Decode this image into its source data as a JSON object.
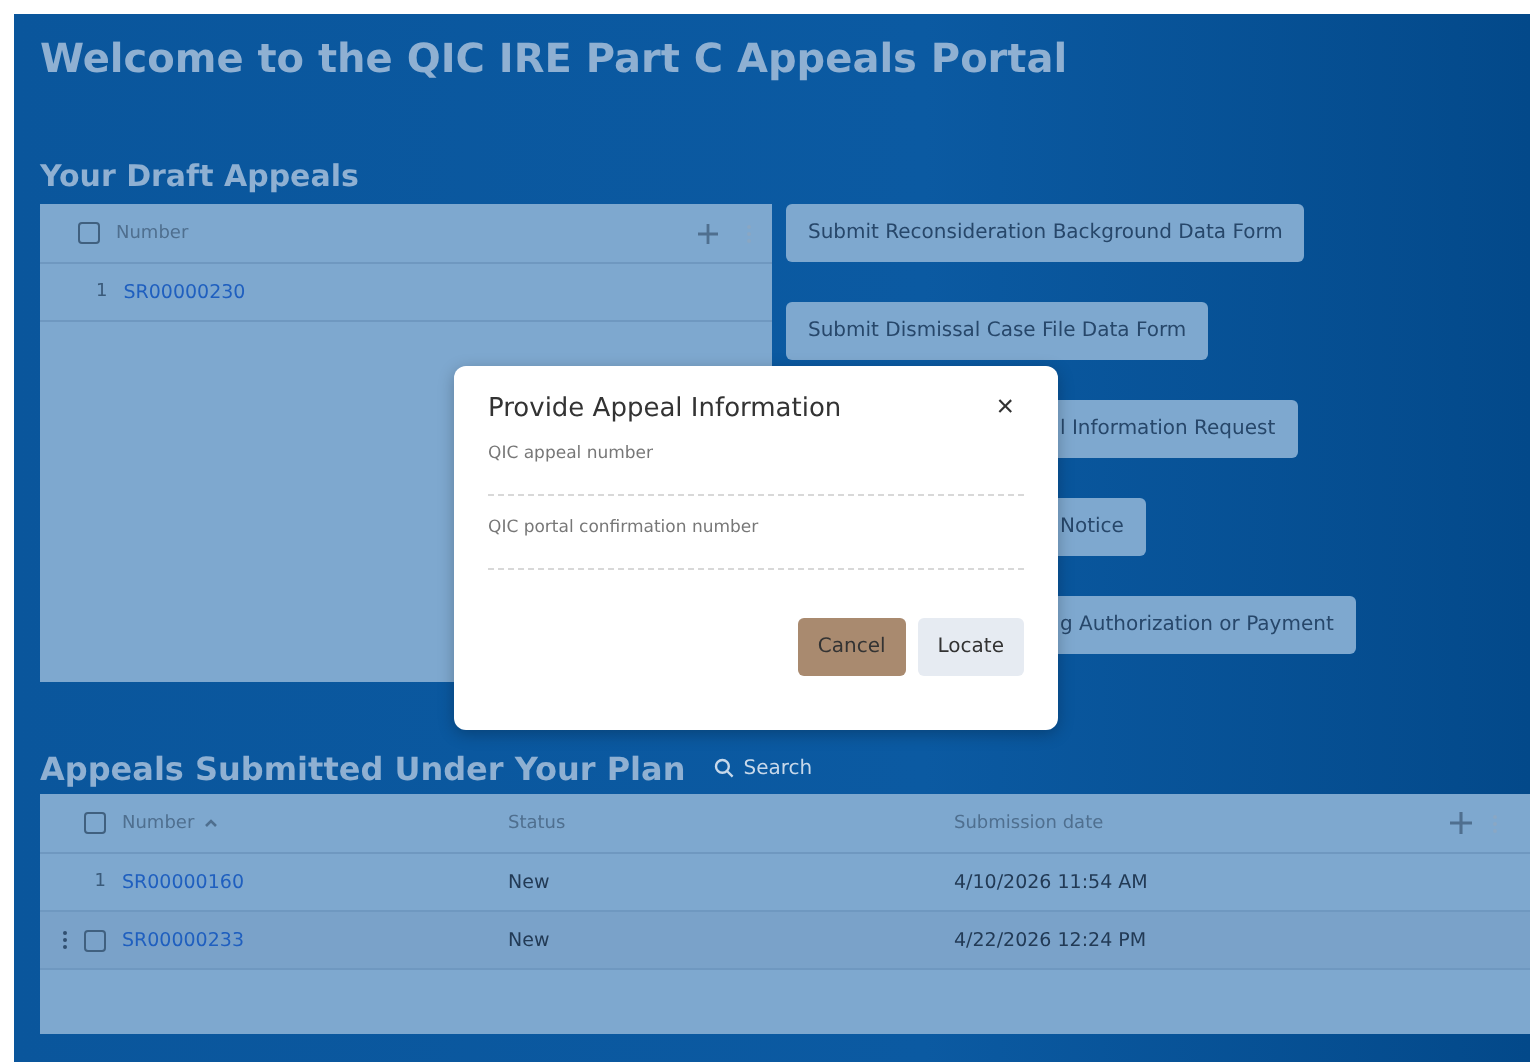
{
  "page_title": "Welcome to the QIC IRE Part C Appeals Portal",
  "draft_appeals": {
    "heading": "Your Draft Appeals",
    "select_all_checked": false,
    "columns": [
      {
        "label": "Number"
      }
    ],
    "rows": [
      {
        "index": "1",
        "number": "SR00000230"
      }
    ]
  },
  "actions": [
    {
      "label": "Submit Reconsideration Background Data Form",
      "kind": "full"
    },
    {
      "label": "Submit Dismissal Case File Data Form",
      "kind": "full"
    },
    {
      "label": "l Information Request",
      "kind": "partial"
    },
    {
      "label": "Notice",
      "kind": "partial"
    },
    {
      "label": "g Authorization or Payment",
      "kind": "partial"
    }
  ],
  "submitted_appeals": {
    "heading": "Appeals Submitted Under Your Plan",
    "search": {
      "placeholder": "Search"
    },
    "select_all_checked": false,
    "columns": [
      {
        "label": "Number",
        "sorted": true
      },
      {
        "label": "Status",
        "sorted": false
      },
      {
        "label": "Submission date",
        "sorted": false
      }
    ],
    "rows": [
      {
        "index": "1",
        "number": "SR00000160",
        "status": "New",
        "date": "4/10/2026 11:54 AM",
        "hovered": false
      },
      {
        "number": "SR00000233",
        "status": "New",
        "date": "4/22/2026 12:24 PM",
        "hovered": true,
        "checked": false
      }
    ]
  },
  "dialog": {
    "title": "Provide Appeal Information",
    "close": "×",
    "fields": [
      {
        "placeholder": "QIC appeal number"
      },
      {
        "placeholder": "QIC portal confirmation number"
      }
    ],
    "buttons": [
      {
        "label": "Cancel",
        "kind": "cancel"
      },
      {
        "label": "Locate",
        "kind": "confirm"
      }
    ]
  }
}
